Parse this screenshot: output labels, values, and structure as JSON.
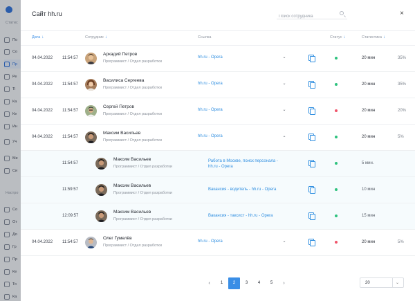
{
  "modal": {
    "title": "Сайт hh.ru",
    "search_placeholder": "Поиск сотрудника",
    "close": "×"
  },
  "columns": {
    "date": "Дата",
    "employee": "Сотрудник",
    "link": "Ссылка",
    "status": "Статус",
    "stats": "Статистика",
    "sort_arrow": "↓"
  },
  "rows": [
    {
      "date": "04.04.2022",
      "time": "11:54:57",
      "name": "Аркадий  Петров",
      "position": "Программист / Отдел разработки",
      "link": "hh.ru - Opera",
      "chevron": "⌄",
      "status_color": "#2ec27e",
      "stat": "20 мин",
      "pct": "35%"
    },
    {
      "date": "04.04.2022",
      "time": "11:54:57",
      "name": "Василиса Сергеева",
      "position": "Программист / Отдел разработки",
      "link": "hh.ru - Opera",
      "chevron": "⌄",
      "status_color": "#2ec27e",
      "stat": "20 мин",
      "pct": "35%"
    },
    {
      "date": "04.04.2022",
      "time": "11:54:57",
      "name": "Сергей Петров",
      "position": "Программист / Отдел разработки",
      "link": "hh.ru - Opera",
      "chevron": "⌄",
      "status_color": "#f0556b",
      "stat": "20 мин",
      "pct": "20%"
    },
    {
      "date": "04.04.2022",
      "time": "11:54:57",
      "name": "Максим Васильев",
      "position": "Программист / Отдел разработки",
      "link": "hh.ru - Opera",
      "chevron": "⌃",
      "status_color": "#2ec27e",
      "stat": "20 мин",
      "pct": "5%"
    }
  ],
  "subrows": [
    {
      "time": "11:54:57",
      "name": "Максим Васильев",
      "position": "Программист / Отдел разработки",
      "link_line1": "Работа в Москве, поиск персонала -",
      "link_line2": "hh.ru - Opera",
      "status_color": "#2ec27e",
      "stat": "5 мин."
    },
    {
      "time": "11:59:57",
      "name": "Максим Васильев",
      "position": "Программист / Отдел разработки",
      "link_line1": "Вакансия - водитель - hh.ru - Opera",
      "link_line2": "",
      "status_color": "#2ec27e",
      "stat": "10 мин"
    },
    {
      "time": "12:09:57",
      "name": "Максим Васильев",
      "position": "Программист / Отдел разработки",
      "link_line1": "Вакансия - таксист - hh.ru - Opera",
      "link_line2": "",
      "status_color": "#2ec27e",
      "stat": "15 мин"
    }
  ],
  "last_row": {
    "date": "04.04.2022",
    "time": "11:54:57",
    "name": "Олег Гумелёв",
    "position": "Программист / Отдел разработки",
    "link": "hh.ru - Opera",
    "chevron": "⌄",
    "status_color": "#f0556b",
    "stat": "20 мин",
    "pct": "5%"
  },
  "pagination": {
    "prev": "‹",
    "next": "›",
    "pages": [
      "1",
      "2",
      "3",
      "4",
      "5"
    ],
    "active": "2",
    "per_page": "20",
    "per_page_arrow": "⌄"
  }
}
